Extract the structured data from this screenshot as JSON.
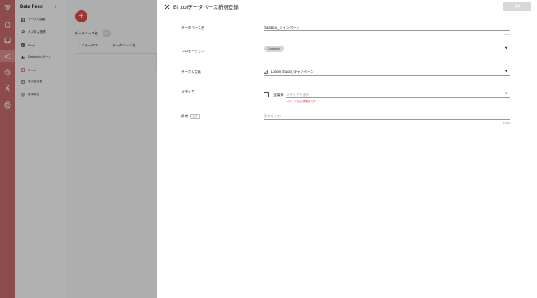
{
  "sidebar": {
    "title": "Data Feed",
    "items": [
      {
        "label": "テーブル定義",
        "icon": "table-icon"
      },
      {
        "label": "カスタム指標",
        "icon": "wrench-icon"
      },
      {
        "label": "Excel",
        "icon": "excel-icon"
      },
      {
        "label": "Databeatレポート",
        "icon": "bar-chart-icon"
      },
      {
        "label": "BI tool",
        "icon": "bi-tool-icon"
      },
      {
        "label": "表示名変更",
        "icon": "rename-icon"
      },
      {
        "label": "基本設定",
        "icon": "gear-icon"
      }
    ]
  },
  "background": {
    "add_button": "+",
    "database_name_label": "データベース名：",
    "columns": [
      "ステータス",
      "データベース名"
    ]
  },
  "drawer": {
    "title": "BI toolデータベース新規登録",
    "register_label": "登録",
    "fields": {
      "db_name": {
        "label": "データベース名",
        "value": "Databeat_キャンペーン",
        "counter": "21/100"
      },
      "promotion": {
        "label": "プロモーション",
        "chip": "Databeat"
      },
      "table_def": {
        "label": "テーブル定義",
        "value": "Looker Studio_キャンペーン"
      },
      "media": {
        "label": "メディア",
        "all_label": "全媒体",
        "placeholder": "メディアを選択",
        "error": "メディアは必須項目です"
      },
      "note": {
        "label": "備考",
        "optional": "任意",
        "placeholder": "備考を入力",
        "counter": "0/1000"
      }
    }
  },
  "colors": {
    "accent": "#d94c4c",
    "rail": "#c26a6a",
    "error": "#d05050"
  }
}
